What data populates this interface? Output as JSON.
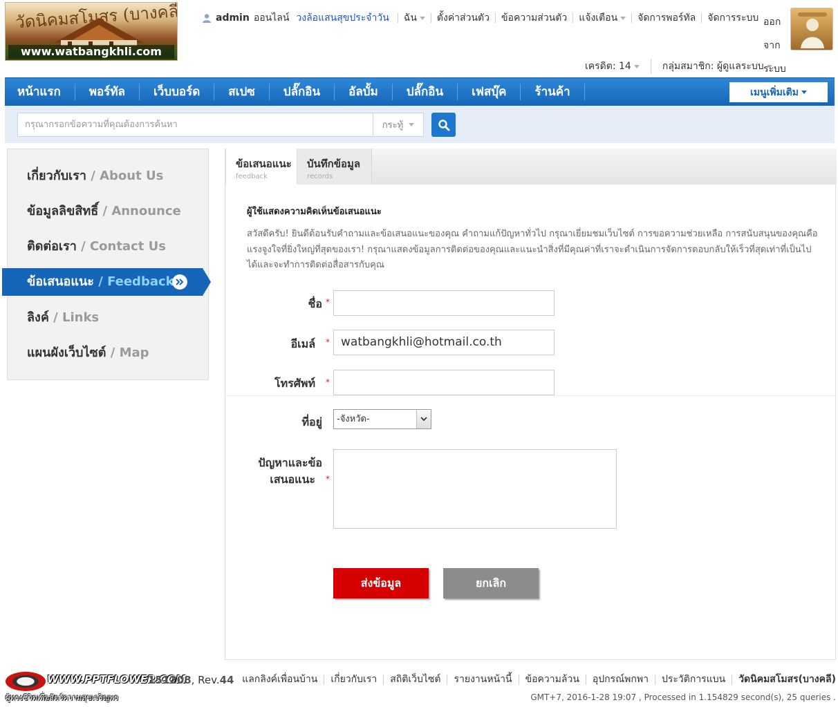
{
  "header": {
    "logo_script": "วัดนิคมสโมสร (บางคลี)",
    "logo_url": "www.watbangkhli.com",
    "user": {
      "name": "admin",
      "status": "ออนไลน์",
      "group_link": "วงล้อแสนสุขประจำวัน"
    },
    "toolbar": [
      {
        "label": "ฉัน",
        "caret": true
      },
      {
        "label": "ตั้งค่าส่วนตัว",
        "caret": false
      },
      {
        "label": "ข้อความส่วนตัว",
        "caret": false
      },
      {
        "label": "แจ้งเตือน",
        "caret": true
      },
      {
        "label": "จัดการพอร์ทัล",
        "caret": false
      },
      {
        "label": "จัดการระบบ",
        "caret": false
      }
    ],
    "logout": "ออกจากระบบ",
    "credit": "เครดิต: 14",
    "member_group": "กลุ่มสมาชิก: ผู้ดูแลระบบ"
  },
  "nav": {
    "items": [
      "หน้าแรก",
      "พอร์ทัล",
      "เว็บบอร์ด",
      "สเปซ",
      "ปลั๊กอิน",
      "อัลบั้ม",
      "ปลั๊กอิน",
      "เฟสบุ๊ค",
      "ร้านค้า"
    ],
    "more_menu": "เมนูเพิ่มเติม"
  },
  "search": {
    "placeholder": "กรุณากรอกข้อความที่คุณต้องการค้นหา",
    "type": "กระทู้"
  },
  "sidebar": {
    "items": [
      {
        "th": "เกี่ยวกับเรา",
        "en": "About Us",
        "active": false
      },
      {
        "th": "ข้อมูลลิขสิทธิ์",
        "en": "Announce",
        "active": false
      },
      {
        "th": "ติดต่อเรา",
        "en": "Contact Us",
        "active": false
      },
      {
        "th": "ข้อเสนอแนะ",
        "en": "Feedback",
        "active": true
      },
      {
        "th": "ลิงค์",
        "en": "Links",
        "active": false
      },
      {
        "th": "แผนผังเว็บไซต์",
        "en": "Map",
        "active": false
      }
    ]
  },
  "tabs": [
    {
      "label": "ข้อเสนอแนะ",
      "sub": "feedback",
      "active": true
    },
    {
      "label": "บันทึกข้อมูล",
      "sub": "records",
      "active": false
    }
  ],
  "form": {
    "title": "ผู้ใช้แสดงความคิดเห็นข้อเสนอแนะ",
    "intro": "สวัสดีครับ! ยินดีต้อนรับคำถามและข้อเสนอแนะของคุณ คำถามแก้ปัญหาทั่วไป กรุณาเยี่ยมชมเว็บไซต์ การขอความช่วยเหลือ การสนับสนุนของคุณคือแรงจูงใจที่ยิ่งใหญ่ที่สุดของเรา! กรุณาแสดงข้อมูลการติดต่อของคุณและแนะนำสิ่งที่มีคุณค่าที่เราจะดำเนินการจัดการตอบกลับให้เร็วที่สุดเท่าที่เป็นไปได้และจะทำการติดต่อสื่อสารกับคุณ",
    "name_label": "ชื่อ",
    "name_value": "",
    "email_label": "อีเมล์",
    "email_value": "watbangkhli@hotmail.co.th",
    "phone_label": "โทรศัพท์",
    "phone_value": "",
    "address_label": "ที่อยู่",
    "address_selected": "-จังหวัด-",
    "problem_label_1": "ปัญหาและข้อ",
    "problem_label_2": "เสนอแนะ",
    "required_mark": "*",
    "submit": "ส่งข้อมูล",
    "cancel": "ยกเลิก"
  },
  "footer": {
    "logo_text": "WWW.PPTFLOWER.COM",
    "logo_sub": "ผู้ทรงชีวิตเพื่อสัตว์ความสุขเจริญพร",
    "version_prefix": "151208",
    "version_sep": ", Rev.",
    "rev": "44",
    "links": [
      "แลกลิงค์เพื่อนบ้าน",
      "เกี่ยวกับเรา",
      "สถิติเว็บไซต์",
      "รายงานหน้านี้",
      "ข้อความล้วน",
      "อุปกรณ์พกพา",
      "ประวัติการแบน"
    ],
    "site_name": "วัดนิคมสโมสร(บางคลี)",
    "processed": "GMT+7, 2016-1-28 19:07 , Processed in 1.154829 second(s), 25 queries ."
  },
  "colors": {
    "nav_blue": "#1565b8",
    "submit_red": "#d70000",
    "cancel_gray": "#8c8c8c",
    "link_blue": "#1b57c9",
    "required_red": "#d61f1f"
  }
}
